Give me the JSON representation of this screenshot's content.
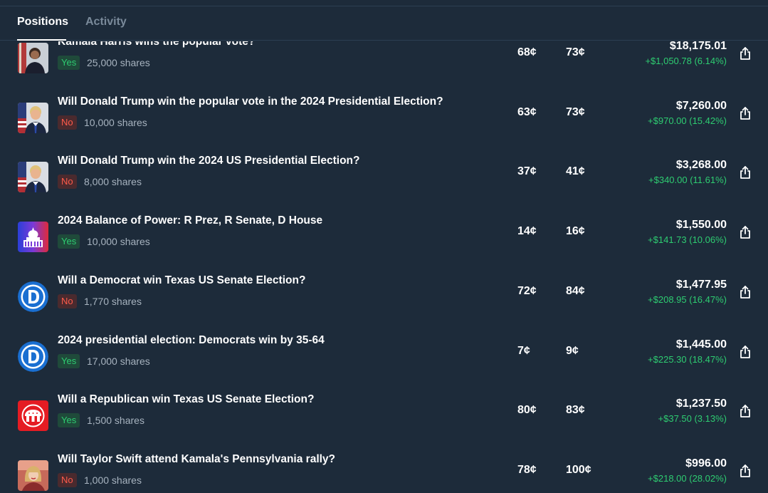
{
  "tabs": [
    {
      "label": "Positions",
      "active": true
    },
    {
      "label": "Activity",
      "active": false
    }
  ],
  "colors": {
    "background": "#1d2b3a",
    "yes": "#2ecc71",
    "no": "#ff5b4b",
    "pnl": "#2ecc71"
  },
  "positions": [
    {
      "title": "Kamala Harris wins the popular vote?",
      "outcome": "Yes",
      "shares": "25,000 shares",
      "avg": "68¢",
      "current": "73¢",
      "value": "$18,175.01",
      "pnl": "+$1,050.78 (6.14%)",
      "thumb": "harris-portrait-icon"
    },
    {
      "title": "Will Donald Trump win the popular vote in the 2024 Presidential Election?",
      "outcome": "No",
      "shares": "10,000 shares",
      "avg": "63¢",
      "current": "73¢",
      "value": "$7,260.00",
      "pnl": "+$970.00 (15.42%)",
      "thumb": "trump-portrait-icon"
    },
    {
      "title": "Will Donald Trump win the 2024 US Presidential Election?",
      "outcome": "No",
      "shares": "8,000 shares",
      "avg": "37¢",
      "current": "41¢",
      "value": "$3,268.00",
      "pnl": "+$340.00 (11.61%)",
      "thumb": "trump-portrait-icon"
    },
    {
      "title": "2024 Balance of Power: R Prez, R Senate, D House",
      "outcome": "Yes",
      "shares": "10,000 shares",
      "avg": "14¢",
      "current": "16¢",
      "value": "$1,550.00",
      "pnl": "+$141.73 (10.06%)",
      "thumb": "capitol-icon"
    },
    {
      "title": "Will a Democrat win Texas US Senate Election?",
      "outcome": "No",
      "shares": "1,770 shares",
      "avg": "72¢",
      "current": "84¢",
      "value": "$1,477.95",
      "pnl": "+$208.95 (16.47%)",
      "thumb": "democrat-logo-icon"
    },
    {
      "title": "2024 presidential election: Democrats win by 35-64",
      "outcome": "Yes",
      "shares": "17,000 shares",
      "avg": "7¢",
      "current": "9¢",
      "value": "$1,445.00",
      "pnl": "+$225.30 (18.47%)",
      "thumb": "democrat-logo-icon"
    },
    {
      "title": "Will a Republican win Texas US Senate Election?",
      "outcome": "Yes",
      "shares": "1,500 shares",
      "avg": "80¢",
      "current": "83¢",
      "value": "$1,237.50",
      "pnl": "+$37.50 (3.13%)",
      "thumb": "republican-logo-icon"
    },
    {
      "title": "Will Taylor Swift attend Kamala's Pennsylvania rally?",
      "outcome": "No",
      "shares": "1,000 shares",
      "avg": "78¢",
      "current": "100¢",
      "value": "$996.00",
      "pnl": "+$218.00 (28.02%)",
      "thumb": "taylor-swift-portrait-icon"
    }
  ]
}
